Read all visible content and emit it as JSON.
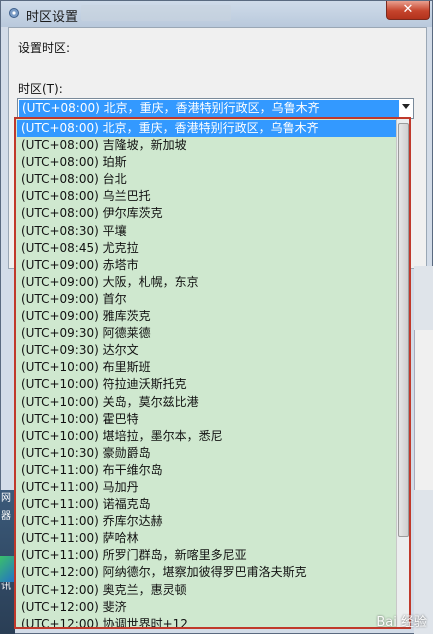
{
  "window": {
    "title": "时区设置",
    "close_label": "✕"
  },
  "form": {
    "prompt": "设置时区:",
    "tz_label": "时区(T):",
    "selected_value": "(UTC+08:00) 北京，重庆，香港特别行政区，乌鲁木齐"
  },
  "timezones": [
    "(UTC+08:00) 北京，重庆，香港特别行政区，乌鲁木齐",
    "(UTC+08:00) 吉隆坡，新加坡",
    "(UTC+08:00) 珀斯",
    "(UTC+08:00) 台北",
    "(UTC+08:00) 乌兰巴托",
    "(UTC+08:00) 伊尔库茨克",
    "(UTC+08:30) 平壤",
    "(UTC+08:45) 尤克拉",
    "(UTC+09:00) 赤塔市",
    "(UTC+09:00) 大阪，札幌，东京",
    "(UTC+09:00) 首尔",
    "(UTC+09:00) 雅库茨克",
    "(UTC+09:30) 阿德莱德",
    "(UTC+09:30) 达尔文",
    "(UTC+10:00) 布里斯班",
    "(UTC+10:00) 符拉迪沃斯托克",
    "(UTC+10:00) 关岛，莫尔兹比港",
    "(UTC+10:00) 霍巴特",
    "(UTC+10:00) 堪培拉，墨尔本，悉尼",
    "(UTC+10:30) 豪勋爵岛",
    "(UTC+11:00) 布干维尔岛",
    "(UTC+11:00) 马加丹",
    "(UTC+11:00) 诺福克岛",
    "(UTC+11:00) 乔库尔达赫",
    "(UTC+11:00) 萨哈林",
    "(UTC+11:00) 所罗门群岛，新喀里多尼亚",
    "(UTC+12:00) 阿纳德尔，堪察加彼得罗巴甫洛夫斯克",
    "(UTC+12:00) 奥克兰，惠灵顿",
    "(UTC+12:00) 斐济",
    "(UTC+12:00) 协调世界时+12"
  ],
  "background_window": {
    "side_text": [
      "网",
      "器",
      "讯"
    ]
  },
  "watermark": "Bai 经验",
  "colors": {
    "selection": "#3399ff",
    "list_bg": "#cfe8cf",
    "highlight_border": "#c0392b"
  }
}
